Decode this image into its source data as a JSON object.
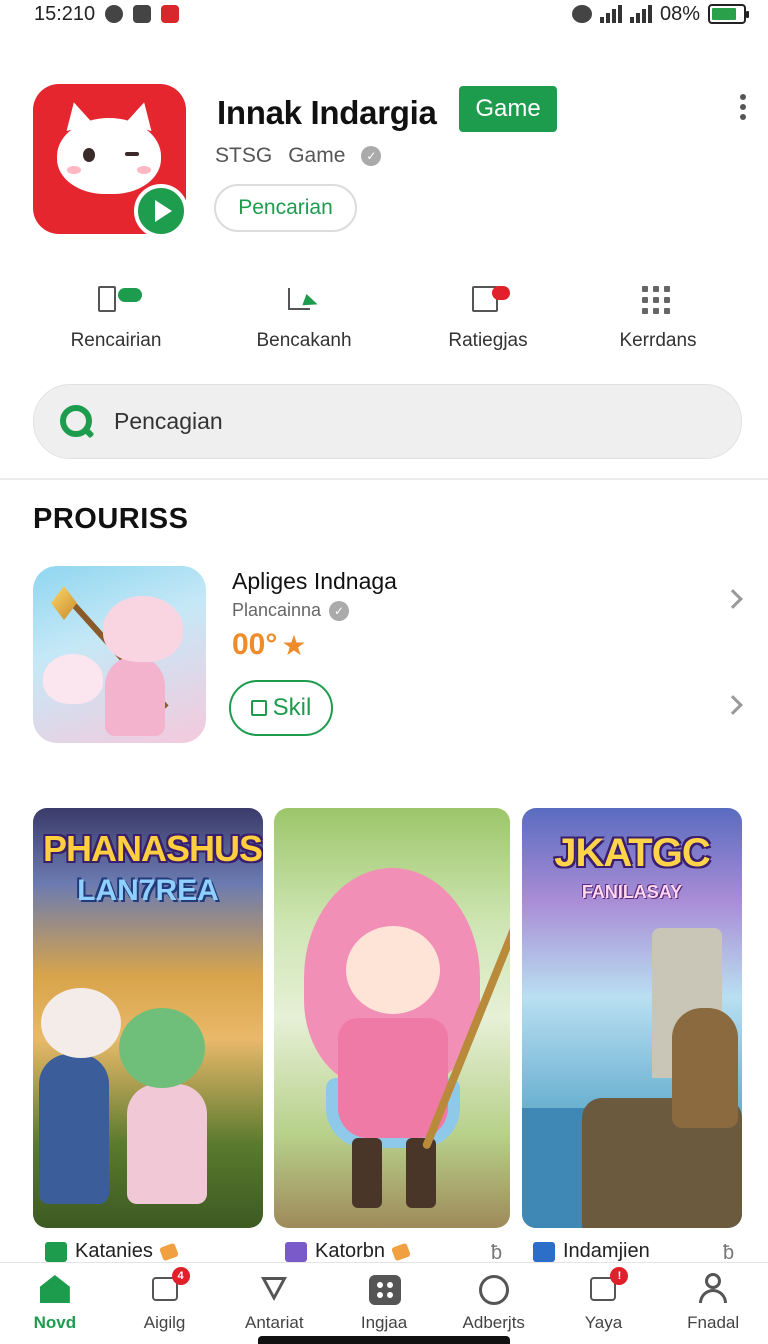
{
  "status_bar": {
    "time": "15:210",
    "battery_text": "08%",
    "battery_level": 0.8
  },
  "app": {
    "title": "Innak Indargia",
    "badge": "Game",
    "developer": "STSG",
    "category": "Game",
    "action_pill": "Pencarian",
    "icon_color": "#e5262f",
    "accent_color": "#1e9c4d"
  },
  "quick_actions": [
    {
      "label": "Rencairian",
      "icon": "phone-badge-icon"
    },
    {
      "label": "Bencakanh",
      "icon": "share-arrow-icon"
    },
    {
      "label": "Ratiegjas",
      "icon": "notification-box-icon"
    },
    {
      "label": "Kerrdans",
      "icon": "grid-dots-icon"
    }
  ],
  "search": {
    "placeholder": "Pencagian"
  },
  "section": {
    "title": "PROURISS"
  },
  "featured": {
    "name": "Apliges Indnaga",
    "developer": "Plancainna",
    "rating": "00°",
    "button": "Skil"
  },
  "game_cards": [
    {
      "title": "PHANASHUS",
      "subtitle": "LAN7REA",
      "caption": "Katanies"
    },
    {
      "title": "",
      "subtitle": "",
      "caption": "Katorbn"
    },
    {
      "title": "JKATGC",
      "subtitle": "FANILASAY",
      "caption": "Indamjien"
    }
  ],
  "bottom_nav": [
    {
      "label": "Novd",
      "icon": "home-icon",
      "active": true
    },
    {
      "label": "Aigilg",
      "icon": "apps-badge-icon",
      "badge": "4"
    },
    {
      "label": "Antariat",
      "icon": "send-icon"
    },
    {
      "label": "Ingjaa",
      "icon": "grid-box-icon"
    },
    {
      "label": "Adberjts",
      "icon": "compass-icon"
    },
    {
      "label": "Yaya",
      "icon": "chat-badge-icon",
      "badge": "!"
    },
    {
      "label": "Fnadal",
      "icon": "person-icon"
    }
  ]
}
